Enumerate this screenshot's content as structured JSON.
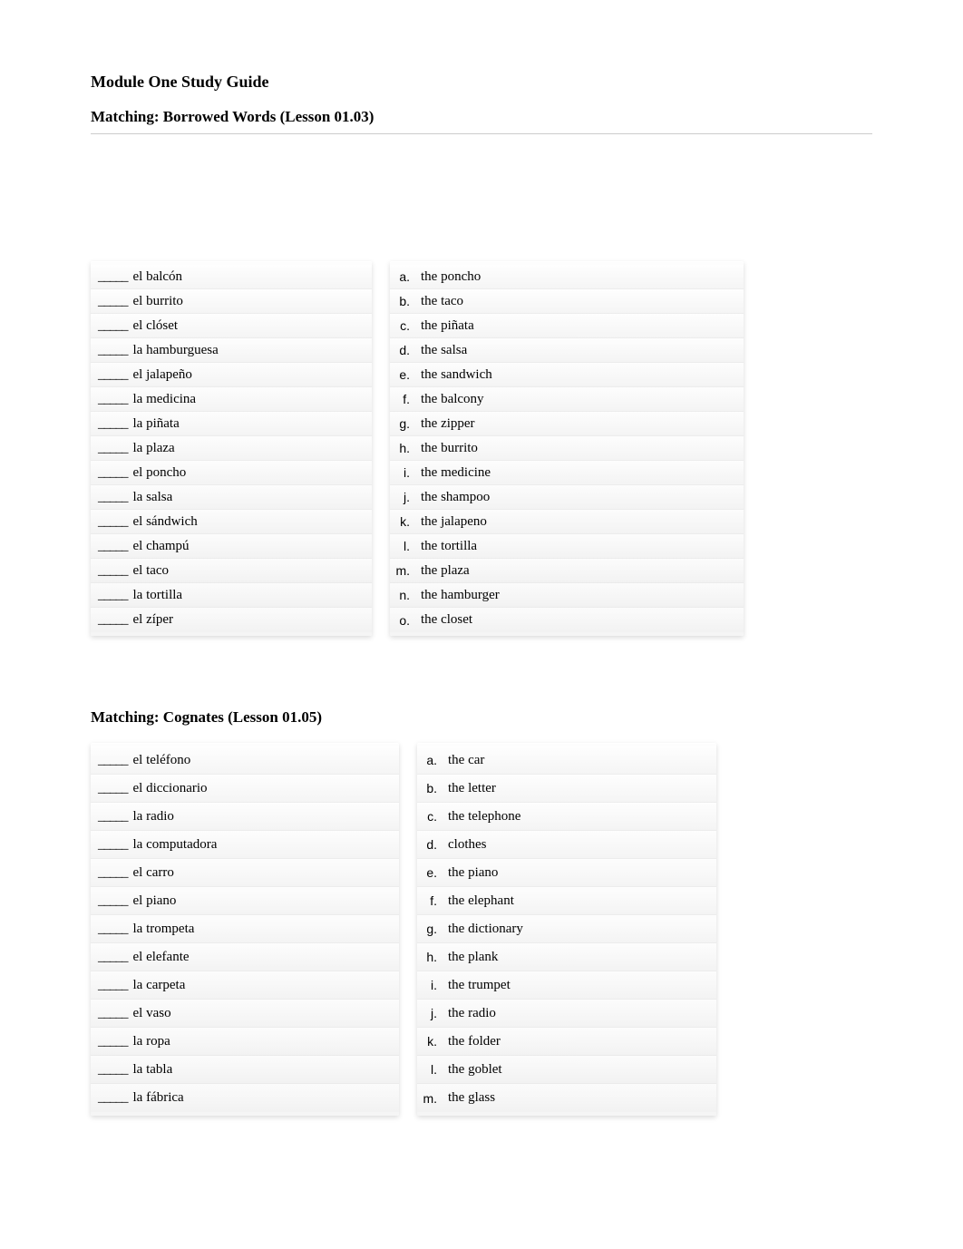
{
  "title": "Module One Study Guide",
  "section1": {
    "heading": "Matching: Borrowed Words (Lesson 01.03)",
    "left": [
      "el balcón",
      "el burrito",
      "el clóset",
      "la hamburguesa",
      "el jalapeño",
      "la medicina",
      "la piñata",
      "la plaza",
      "el poncho",
      "la salsa",
      "el sándwich",
      "el champú",
      "el taco",
      "la tortilla",
      "el zíper"
    ],
    "right": [
      {
        "letter": "a.",
        "text": "the poncho"
      },
      {
        "letter": "b.",
        "text": "the taco"
      },
      {
        "letter": "c.",
        "text": "the piñata"
      },
      {
        "letter": "d.",
        "text": "the salsa"
      },
      {
        "letter": "e.",
        "text": "the sandwich"
      },
      {
        "letter": "f.",
        "text": "the balcony"
      },
      {
        "letter": "g.",
        "text": "the zipper"
      },
      {
        "letter": "h.",
        "text": "the burrito"
      },
      {
        "letter": "i.",
        "text": "the medicine"
      },
      {
        "letter": "j.",
        "text": "the shampoo"
      },
      {
        "letter": "k.",
        "text": "the jalapeno"
      },
      {
        "letter": "l.",
        "text": "the tortilla"
      },
      {
        "letter": "m.",
        "text": "the plaza"
      },
      {
        "letter": "n.",
        "text": "the hamburger"
      },
      {
        "letter": "o.",
        "text": "the closet"
      }
    ]
  },
  "section2": {
    "heading": "Matching: Cognates (Lesson 01.05)",
    "left": [
      "el teléfono",
      "el diccionario",
      "la radio",
      "la computadora",
      "el carro",
      "el piano",
      "la trompeta",
      "el elefante",
      "la carpeta",
      "el vaso",
      "la ropa",
      "la tabla",
      "la fábrica"
    ],
    "right": [
      {
        "letter": "a.",
        "text": "the car"
      },
      {
        "letter": "b.",
        "text": "the letter"
      },
      {
        "letter": "c.",
        "text": "the telephone"
      },
      {
        "letter": "d.",
        "text": "clothes"
      },
      {
        "letter": "e.",
        "text": "the piano"
      },
      {
        "letter": "f.",
        "text": "the elephant"
      },
      {
        "letter": "g.",
        "text": "the dictionary"
      },
      {
        "letter": "h.",
        "text": "the plank"
      },
      {
        "letter": "i.",
        "text": "the trumpet"
      },
      {
        "letter": "j.",
        "text": "the radio"
      },
      {
        "letter": "k.",
        "text": "the folder"
      },
      {
        "letter": "l.",
        "text": "the goblet"
      },
      {
        "letter": "m.",
        "text": "the glass"
      }
    ]
  },
  "blank": "_____"
}
